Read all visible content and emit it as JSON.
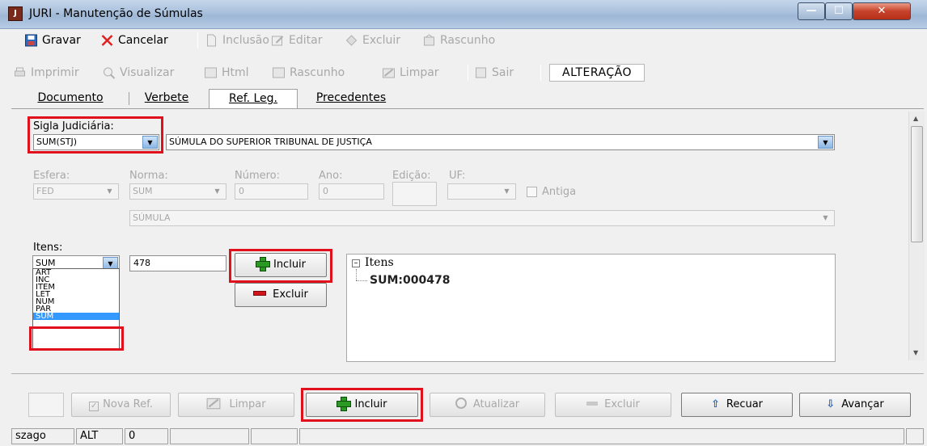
{
  "window": {
    "title": "JURI - Manutenção de Súmulas",
    "icon": "app-icon"
  },
  "toolbar1": {
    "gravar": "Gravar",
    "cancelar": "Cancelar",
    "inclusao": "Inclusão",
    "editar": "Editar",
    "excluir": "Excluir",
    "rascunho": "Rascunho"
  },
  "toolbar2": {
    "imprimir": "Imprimir",
    "visualizar": "Visualizar",
    "html": "Html",
    "rascunho": "Rascunho",
    "limpar": "Limpar",
    "sair": "Sair",
    "mode": "ALTERAÇÃO"
  },
  "tabs": [
    {
      "label": "Documento"
    },
    {
      "label": "Verbete"
    },
    {
      "label": "Ref. Leg.",
      "active": true
    },
    {
      "label": "Precedentes"
    }
  ],
  "form": {
    "sigla_label": "Sigla Judiciária:",
    "sigla_value": "SUM(STJ)",
    "sigla_desc": "SÚMULA DO SUPERIOR TRIBUNAL DE JUSTIÇA",
    "esfera_label": "Esfera:",
    "esfera_value": "FED",
    "norma_label": "Norma:",
    "norma_value": "SUM",
    "numero_label": "Número:",
    "numero_value": "0",
    "ano_label": "Ano:",
    "ano_value": "0",
    "edicao_label": "Edição:",
    "uf_label": "UF:",
    "antiga_label": "Antiga",
    "norma_desc": "SÚMULA",
    "itens_label": "Itens:",
    "itens_value": "SUM",
    "item_number": "478",
    "itens_options": [
      "ART",
      "INC",
      "ITEM",
      "LET",
      "NUM",
      "PAR",
      "SUM"
    ],
    "incluir_label": "Incluir",
    "excluir_label": "Excluir"
  },
  "tree": {
    "root": "Itens",
    "child": "SUM:000478"
  },
  "bottom": {
    "nova_ref": "Nova Ref.",
    "limpar": "Limpar",
    "incluir": "Incluir",
    "atualizar": "Atualizar",
    "excluir": "Excluir",
    "recuar": "Recuar",
    "avancar": "Avançar"
  },
  "status": {
    "user": "szago",
    "mode": "ALT",
    "count": "0"
  },
  "colors": {
    "highlight_red": "#e0101c",
    "selection_blue": "#3399ff",
    "add_green": "#2a9a22"
  }
}
